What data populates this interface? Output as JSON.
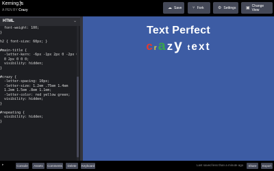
{
  "header": {
    "title": "Kerning.js",
    "by_label": "A PEN BY",
    "author": "Crazy",
    "buttons": {
      "save": "Save",
      "fork": "Fork",
      "settings": "Settings",
      "change_view": "Change View"
    }
  },
  "editor": {
    "language": "HTML",
    "lines": [
      "  font-weight: 100;",
      "}",
      "",
      "h2 { font-size: 60px; }",
      "",
      "#main-title {",
      "  -letter-kern: -6px -1px 2px 0 -2px 0",
      "  0 2px 0 0 0;",
      "  visibility: hidden;",
      "}",
      "",
      "#crazy {",
      "  -letter-spacing: 10px;",
      "  -letter-size: 1.2em .75em 1.4em",
      "  1.2em 1.5em .8em 1.1em;",
      "  -letter-color: red yellow green;",
      "  visibility: hidden;",
      "}",
      "",
      "#repeating {",
      "  visibility: hidden;",
      "}"
    ]
  },
  "preview": {
    "title_line": "Text Perfect",
    "crazy_letters": [
      {
        "ch": "c",
        "color": "#e53b2c"
      },
      {
        "ch": "r",
        "color": "#e5d635"
      },
      {
        "ch": "a",
        "color": "#3aa64a"
      },
      {
        "ch": "z",
        "color": "#ffffff"
      },
      {
        "ch": "y",
        "color": "#ffffff"
      },
      {
        "ch": " ",
        "color": "#ffffff"
      },
      {
        "ch": "t",
        "color": "#ffffff"
      },
      {
        "ch": "e",
        "color": "#ffffff"
      },
      {
        "ch": "x",
        "color": "#ffffff"
      },
      {
        "ch": "t",
        "color": "#ffffff"
      }
    ],
    "background": "#3d5ca4"
  },
  "footer": {
    "buttons": [
      "Console",
      "Assets",
      "Comments",
      "Delete",
      "Keyboard"
    ],
    "status": "Last saved less than a minute ago",
    "share": "Share",
    "export": "Export"
  },
  "icons": {
    "save": "cloud-icon",
    "fork": "fork-icon",
    "settings": "gear-icon",
    "change_view": "layout-icon"
  }
}
